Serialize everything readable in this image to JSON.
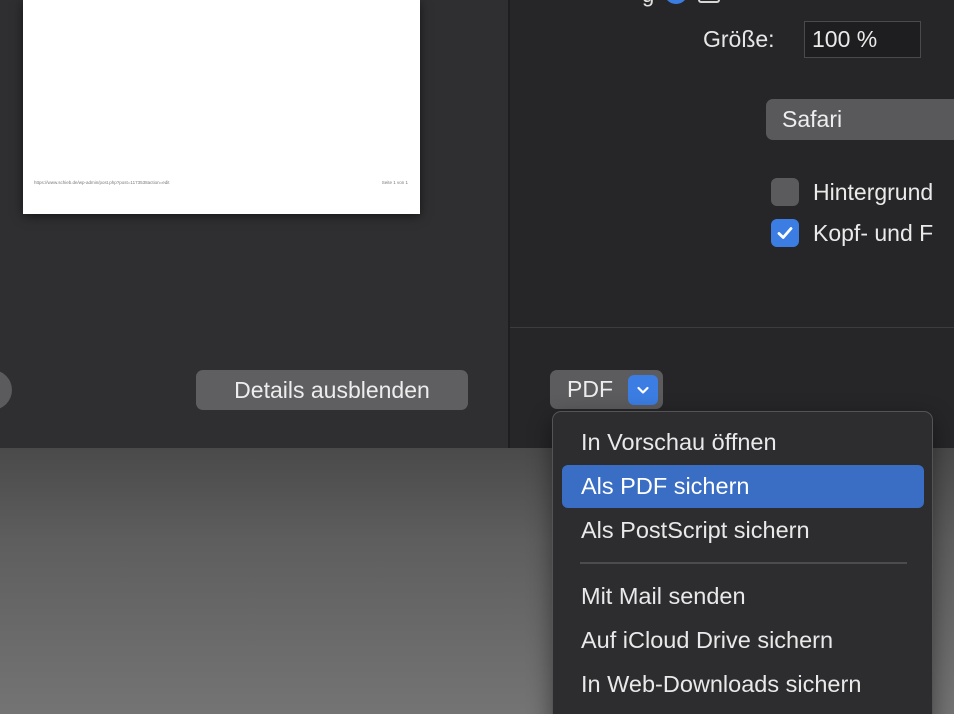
{
  "preview": {
    "page_footer_url": "https://www.schieb.de/wp-admin/post.php?post=1173538action=edit",
    "page_footer_pagenum": "Seite 1 von 1"
  },
  "buttons": {
    "hide_details_label": "Details ausblenden"
  },
  "settings": {
    "size_label": "Größe:",
    "size_value": "100 %",
    "app_select_value": "Safari",
    "options": [
      {
        "label": "Hintergrund",
        "checked": false
      },
      {
        "label": "Kopf- und F",
        "checked": true
      }
    ]
  },
  "pdf_button": {
    "label": "PDF"
  },
  "pdf_menu": {
    "items": [
      "In Vorschau öffnen",
      "Als PDF sichern",
      "Als PostScript sichern",
      "Mit Mail senden",
      "Auf iCloud Drive sichern",
      "In Web-Downloads sichern"
    ],
    "selected_index": 1
  },
  "colors": {
    "accent": "#3b7de3",
    "menu_highlight": "#3a6dc4",
    "dialog_bg": "#2b2b2d"
  }
}
